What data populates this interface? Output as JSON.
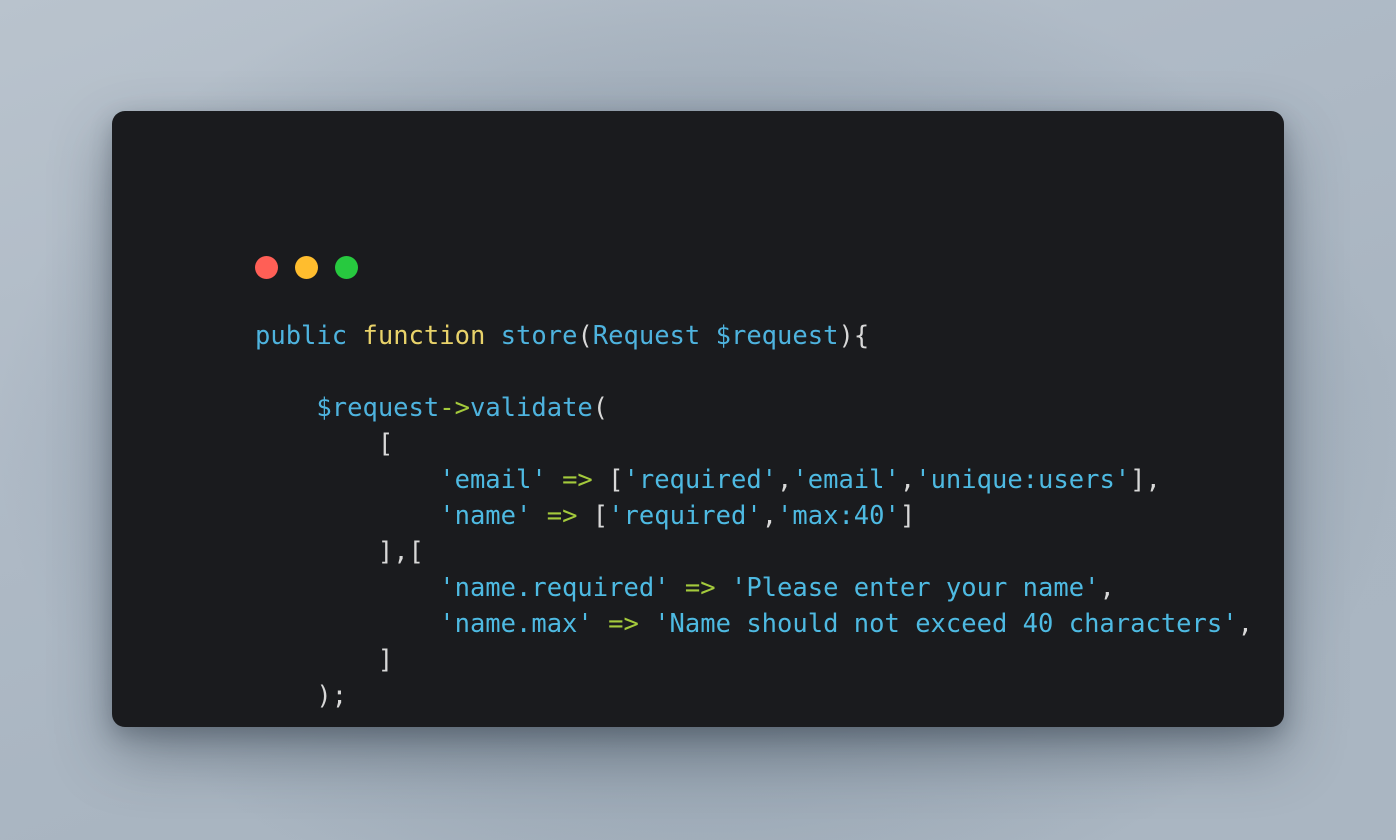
{
  "window": {
    "title": "",
    "controls": [
      {
        "name": "close",
        "color": "#ff5f56"
      },
      {
        "name": "minimize",
        "color": "#ffbd2e"
      },
      {
        "name": "maximize",
        "color": "#27c93f"
      }
    ],
    "background_color": "#1a1b1e",
    "wallpaper_color": "#aeb9c5"
  },
  "syntax_colors": {
    "keyword": "#4eb3de",
    "function_keyword": "#e8d26a",
    "function_name": "#4eb3de",
    "variable": "#4eb3de",
    "string": "#4ebae2",
    "operator": "#a4ca3c",
    "punctuation": "#d8d8d8"
  },
  "code": {
    "language": "php",
    "full_text": "public function store(Request $request){\n\n    $request->validate(\n        [\n            'email' => ['required','email','unique:users'],\n            'name' => ['required','max:40']\n        ],[\n            'name.required' => 'Please enter your name',\n            'name.max' => 'Name should not exceed 40 characters',\n        ]\n    );\n\n}",
    "lines": [
      {
        "tokens": [
          {
            "t": "public",
            "c": "kw"
          },
          {
            "t": " ",
            "c": "plain"
          },
          {
            "t": "function",
            "c": "fn"
          },
          {
            "t": " ",
            "c": "plain"
          },
          {
            "t": "store",
            "c": "name"
          },
          {
            "t": "(",
            "c": "punc"
          },
          {
            "t": "Request",
            "c": "var"
          },
          {
            "t": " ",
            "c": "plain"
          },
          {
            "t": "$request",
            "c": "var"
          },
          {
            "t": ")",
            "c": "punc"
          },
          {
            "t": "{",
            "c": "punc"
          }
        ]
      },
      {
        "tokens": []
      },
      {
        "tokens": [
          {
            "t": "    ",
            "c": "plain"
          },
          {
            "t": "$request",
            "c": "var"
          },
          {
            "t": "->",
            "c": "op"
          },
          {
            "t": "validate",
            "c": "name"
          },
          {
            "t": "(",
            "c": "punc"
          }
        ]
      },
      {
        "tokens": [
          {
            "t": "        ",
            "c": "plain"
          },
          {
            "t": "[",
            "c": "punc"
          }
        ]
      },
      {
        "tokens": [
          {
            "t": "            ",
            "c": "plain"
          },
          {
            "t": "'email'",
            "c": "str"
          },
          {
            "t": " ",
            "c": "plain"
          },
          {
            "t": "=>",
            "c": "op"
          },
          {
            "t": " ",
            "c": "plain"
          },
          {
            "t": "[",
            "c": "punc"
          },
          {
            "t": "'required'",
            "c": "str"
          },
          {
            "t": ",",
            "c": "punc"
          },
          {
            "t": "'email'",
            "c": "str"
          },
          {
            "t": ",",
            "c": "punc"
          },
          {
            "t": "'unique:users'",
            "c": "str"
          },
          {
            "t": "]",
            "c": "punc"
          },
          {
            "t": ",",
            "c": "punc"
          }
        ]
      },
      {
        "tokens": [
          {
            "t": "            ",
            "c": "plain"
          },
          {
            "t": "'name'",
            "c": "str"
          },
          {
            "t": " ",
            "c": "plain"
          },
          {
            "t": "=>",
            "c": "op"
          },
          {
            "t": " ",
            "c": "plain"
          },
          {
            "t": "[",
            "c": "punc"
          },
          {
            "t": "'required'",
            "c": "str"
          },
          {
            "t": ",",
            "c": "punc"
          },
          {
            "t": "'max:40'",
            "c": "str"
          },
          {
            "t": "]",
            "c": "punc"
          }
        ]
      },
      {
        "tokens": [
          {
            "t": "        ",
            "c": "plain"
          },
          {
            "t": "]",
            "c": "punc"
          },
          {
            "t": ",",
            "c": "punc"
          },
          {
            "t": "[",
            "c": "punc"
          }
        ]
      },
      {
        "tokens": [
          {
            "t": "            ",
            "c": "plain"
          },
          {
            "t": "'name.required'",
            "c": "str"
          },
          {
            "t": " ",
            "c": "plain"
          },
          {
            "t": "=>",
            "c": "op"
          },
          {
            "t": " ",
            "c": "plain"
          },
          {
            "t": "'Please enter your name'",
            "c": "str"
          },
          {
            "t": ",",
            "c": "punc"
          }
        ]
      },
      {
        "tokens": [
          {
            "t": "            ",
            "c": "plain"
          },
          {
            "t": "'name.max'",
            "c": "str"
          },
          {
            "t": " ",
            "c": "plain"
          },
          {
            "t": "=>",
            "c": "op"
          },
          {
            "t": " ",
            "c": "plain"
          },
          {
            "t": "'Name should not exceed 40 characters'",
            "c": "str"
          },
          {
            "t": ",",
            "c": "punc"
          }
        ]
      },
      {
        "tokens": [
          {
            "t": "        ",
            "c": "plain"
          },
          {
            "t": "]",
            "c": "punc"
          }
        ]
      },
      {
        "tokens": [
          {
            "t": "    ",
            "c": "plain"
          },
          {
            "t": ")",
            "c": "punc"
          },
          {
            "t": ";",
            "c": "punc"
          }
        ]
      },
      {
        "tokens": []
      },
      {
        "tokens": [
          {
            "t": "}",
            "c": "punc"
          }
        ]
      }
    ]
  }
}
